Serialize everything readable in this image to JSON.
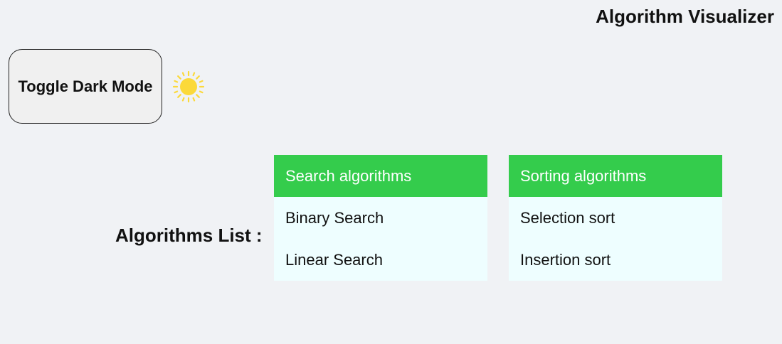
{
  "header": {
    "title": "Algorithm Visualizer"
  },
  "theme_toggle": {
    "label": "Toggle Dark Mode",
    "icon": "sun-icon",
    "icon_color": "#fbd93a"
  },
  "algorithms": {
    "label": "Algorithms List :",
    "menus": [
      {
        "header": "Search algorithms",
        "items": [
          "Binary Search",
          "Linear Search"
        ]
      },
      {
        "header": "Sorting algorithms",
        "items": [
          "Selection sort",
          "Insertion sort"
        ]
      }
    ]
  },
  "colors": {
    "background": "#f0f2f5",
    "menu_header": "#34cc4c",
    "menu_body": "#eefeff"
  }
}
